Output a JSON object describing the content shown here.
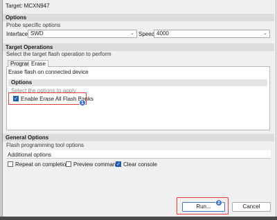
{
  "target": {
    "label": "Target: MCXN947"
  },
  "options": {
    "title": "Options",
    "desc": "Probe specific options",
    "interface_label": "Interface",
    "interface_value": "SWD",
    "speed_label": "Speed",
    "speed_value": "4000"
  },
  "target_ops": {
    "title": "Target Operations",
    "desc": "Select the target flash operation to perform",
    "tabs": [
      "Program",
      "Erase"
    ],
    "active_tab": "Erase",
    "erase_desc": "Erase flash on connected device",
    "inner_title": "Options",
    "inner_desc": "Select the options to apply",
    "erase_all_label": "Enable Erase All Flash Banks",
    "erase_all_checked": true,
    "badge1": "1"
  },
  "general": {
    "title": "General Options",
    "desc": "Flash programming tool options",
    "additional_label": "Additional options",
    "repeat_label": "Repeat on completion",
    "repeat_checked": false,
    "preview_label": "Preview command",
    "preview_checked": false,
    "clear_label": "Clear console",
    "clear_checked": true
  },
  "buttons": {
    "run": "Run...",
    "cancel": "Cancel",
    "badge2": "2"
  },
  "colors": {
    "accent": "#1e5fb4",
    "highlight": "#e23b3b",
    "badge": "#3a6fd6"
  },
  "icons": {
    "check": "✓",
    "chevron": "⌄"
  }
}
